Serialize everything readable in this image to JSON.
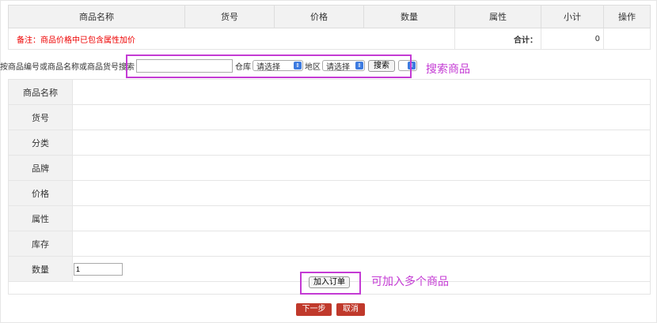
{
  "cart": {
    "headers": [
      "商品名称",
      "货号",
      "价格",
      "数量",
      "属性",
      "小计",
      "操作"
    ],
    "note": "备注：商品价格中已包含属性加价",
    "total_label": "合计：",
    "total_value": "0"
  },
  "search": {
    "label": "按商品编号或商品名称或商品货号搜索",
    "keyword_value": "",
    "warehouse_label": "仓库",
    "warehouse_selected": "请选择",
    "region_label": "地区",
    "region_selected": "请选择",
    "search_button": "搜索",
    "extra_selected": ""
  },
  "annotations": {
    "search_note": "搜索商品",
    "add_note": "可加入多个商品"
  },
  "detail": {
    "rows": [
      {
        "label": "商品名称",
        "value": ""
      },
      {
        "label": "货号",
        "value": ""
      },
      {
        "label": "分类",
        "value": ""
      },
      {
        "label": "品牌",
        "value": ""
      },
      {
        "label": "价格",
        "value": ""
      },
      {
        "label": "属性",
        "value": ""
      },
      {
        "label": "库存",
        "value": ""
      }
    ],
    "qty_label": "数量",
    "qty_value": "1"
  },
  "actions": {
    "add_to_order": "加入订单",
    "next_step": "下一步",
    "cancel": "取消"
  },
  "colors": {
    "highlight": "#c43bd4",
    "primary_red": "#c0392b",
    "note_red": "#ee0000"
  }
}
